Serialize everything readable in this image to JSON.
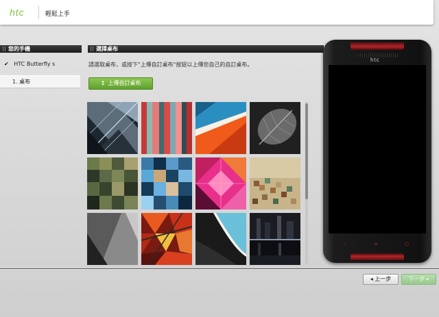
{
  "header": {
    "logo": "htc",
    "title": "輕鬆上手"
  },
  "sidebar": {
    "heading": "您的手機",
    "check_icon": "✔",
    "device": "HTC Butterfly s",
    "step": "1.  桌布"
  },
  "main": {
    "heading": "選擇桌布",
    "instruction": "請選取桌布，或按下\"上傳自訂桌布\"按鈕以上傳您自己的自訂桌布。",
    "upload_icon": "upload-arrow-icon",
    "upload_label": "上傳自訂桌布"
  },
  "wallpapers": [
    {
      "name": "geometric-building-blue"
    },
    {
      "name": "vertical-stripes-colorful"
    },
    {
      "name": "orange-red-triangles"
    },
    {
      "name": "monochrome-leaf"
    },
    {
      "name": "pixel-mosaic-green"
    },
    {
      "name": "pixel-mosaic-blue"
    },
    {
      "name": "pink-magenta-diamonds"
    },
    {
      "name": "pixel-mosaic-beige"
    },
    {
      "name": "dark-gray-shards"
    },
    {
      "name": "red-yellow-fractal"
    },
    {
      "name": "cyan-black-curve"
    },
    {
      "name": "city-night-reflection"
    }
  ],
  "phone": {
    "brand": "htc",
    "softkeys": [
      "‹",
      "⌂",
      "○"
    ],
    "accent_color": "#b0262a"
  },
  "footer": {
    "prev_label": "◂ 上一步",
    "next_label": "下一步 ▸"
  },
  "colors": {
    "brand_green": "#7dc242",
    "upload_button": "#6fb33a",
    "section_bar": "#2a2a2a"
  }
}
